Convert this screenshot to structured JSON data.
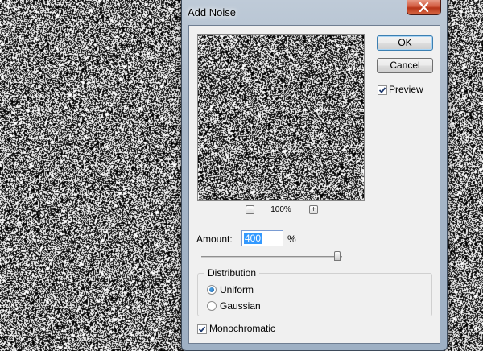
{
  "window": {
    "title": "Add Noise"
  },
  "buttons": {
    "ok": "OK",
    "cancel": "Cancel"
  },
  "preview": {
    "checkbox_label": "Preview",
    "checked": true,
    "zoom": "100%"
  },
  "amount": {
    "label": "Amount:",
    "value": "400",
    "unit": "%",
    "slider_fraction": 1.0
  },
  "distribution": {
    "title": "Distribution",
    "options": [
      {
        "label": "Uniform",
        "selected": true
      },
      {
        "label": "Gaussian",
        "selected": false
      }
    ]
  },
  "monochromatic": {
    "label": "Monochromatic",
    "checked": true
  },
  "icons": {
    "close": "close-x-icon",
    "zoom_out": "minus-icon",
    "zoom_in": "plus-icon"
  },
  "colors": {
    "close_button": "#c8462b",
    "selection": "#3399ff"
  }
}
